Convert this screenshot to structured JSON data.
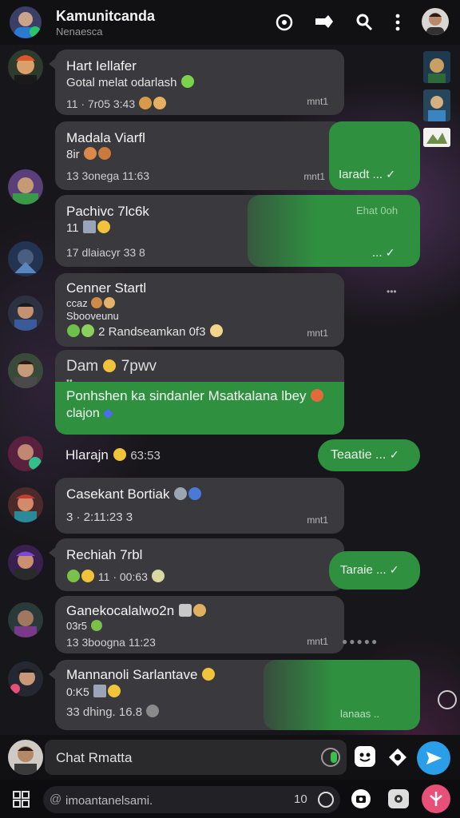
{
  "header": {
    "title": "Kamunitcanda",
    "subtitle": "Nenaesca"
  },
  "messages": [
    {
      "name": "Hart Iellafer",
      "line": "Gotal melat odarlash",
      "meta_left": "11 · 7r05 3:43",
      "meta_right": "mnt1"
    },
    {
      "name": "Madala Viarfl",
      "line": "8ir",
      "meta_left": "13 3onega 11:63",
      "meta_right": "mnt1"
    },
    {
      "name": "Pachivc 7lc6k",
      "line": "11",
      "meta_left": "17 dlaiacyr 33 8",
      "meta_right": ""
    },
    {
      "name": "Cenner Startl",
      "line": "Sbooveunu",
      "line0": "ccaz",
      "meta_left": "2 Randseamkan 0f3",
      "meta_right": "mnt1"
    },
    {
      "name": "Dam",
      "name_suffix": "7pwv",
      "line": "Ponhshen ka sindanler Msatkalana lbey",
      "line2": "clajon",
      "meta_left": "",
      "meta_right": ""
    },
    {
      "name": "Casekant Bortiak",
      "line": "3",
      "meta_left": "3 · 2:11:23 3",
      "meta_right": "mnt1"
    },
    {
      "name": "Rechiah 7rbl",
      "line": "11",
      "meta_left": "11 · 00:63",
      "meta_right": ""
    },
    {
      "name": "Ganekocalalwo2n",
      "line": "03r5",
      "meta_left": "13 3boogna 11:23",
      "meta_right": "mnt1"
    },
    {
      "name": "Mannanoli Sarlantave",
      "line": "0:K5",
      "meta_left": "33 dhing. 16.8",
      "meta_right": ""
    }
  ],
  "inline_row": {
    "text": "Hlarajn",
    "time": "63:53"
  },
  "green_replies": [
    {
      "text": "Iaradt ...",
      "check": "✓"
    },
    {
      "text": "Ehat 0oh",
      "sub": "...",
      "check": "✓"
    },
    {
      "text": "Teaatie ...",
      "check": "✓"
    },
    {
      "text": "Taraie ...",
      "check": "✓"
    },
    {
      "text": "lanaas ..",
      "check": ""
    }
  ],
  "side_labels": {
    "right_meta": "mnt1",
    "dots_label": "•••"
  },
  "compose": {
    "placeholder": "Chat Rmatta"
  },
  "bottom": {
    "search_placeholder": "imoantanelsami.",
    "count": "10"
  },
  "colors": {
    "accent_green": "#2f9140",
    "send_blue": "#2a9ee8",
    "bubble": "#3a3a3e",
    "fab_pink": "#e8507a"
  }
}
